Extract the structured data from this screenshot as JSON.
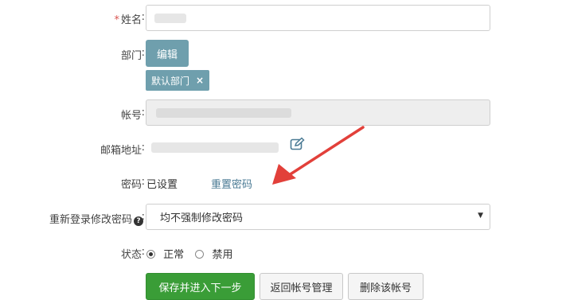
{
  "form": {
    "name": {
      "required_mark": "*",
      "label": "姓名",
      "colon": ":"
    },
    "department": {
      "label": "部门",
      "colon": ":",
      "edit_button": "编辑",
      "tags": [
        {
          "label": "默认部门",
          "remove": "×"
        }
      ]
    },
    "account": {
      "label": "帐号",
      "colon": ":"
    },
    "email": {
      "label": "邮箱地址",
      "colon": ":",
      "edit_icon": "pencil-square-icon"
    },
    "password": {
      "label": "密码",
      "colon": ":",
      "status": "已设置",
      "reset_link": "重置密码"
    },
    "relogin": {
      "label": "重新登录修改密码",
      "colon": ":",
      "help_icon": "?",
      "selected": "均不强制修改密码"
    },
    "status": {
      "label": "状态",
      "colon": ":",
      "options": [
        {
          "label": "正常",
          "checked": true
        },
        {
          "label": "禁用",
          "checked": false
        }
      ]
    }
  },
  "actions": {
    "save_next": "保存并进入下一步",
    "back": "返回帐号管理",
    "delete": "删除该帐号"
  },
  "colors": {
    "accent_teal": "#6f9fad",
    "primary_green": "#3a9d37",
    "annotation_arrow": "#e2403a"
  }
}
